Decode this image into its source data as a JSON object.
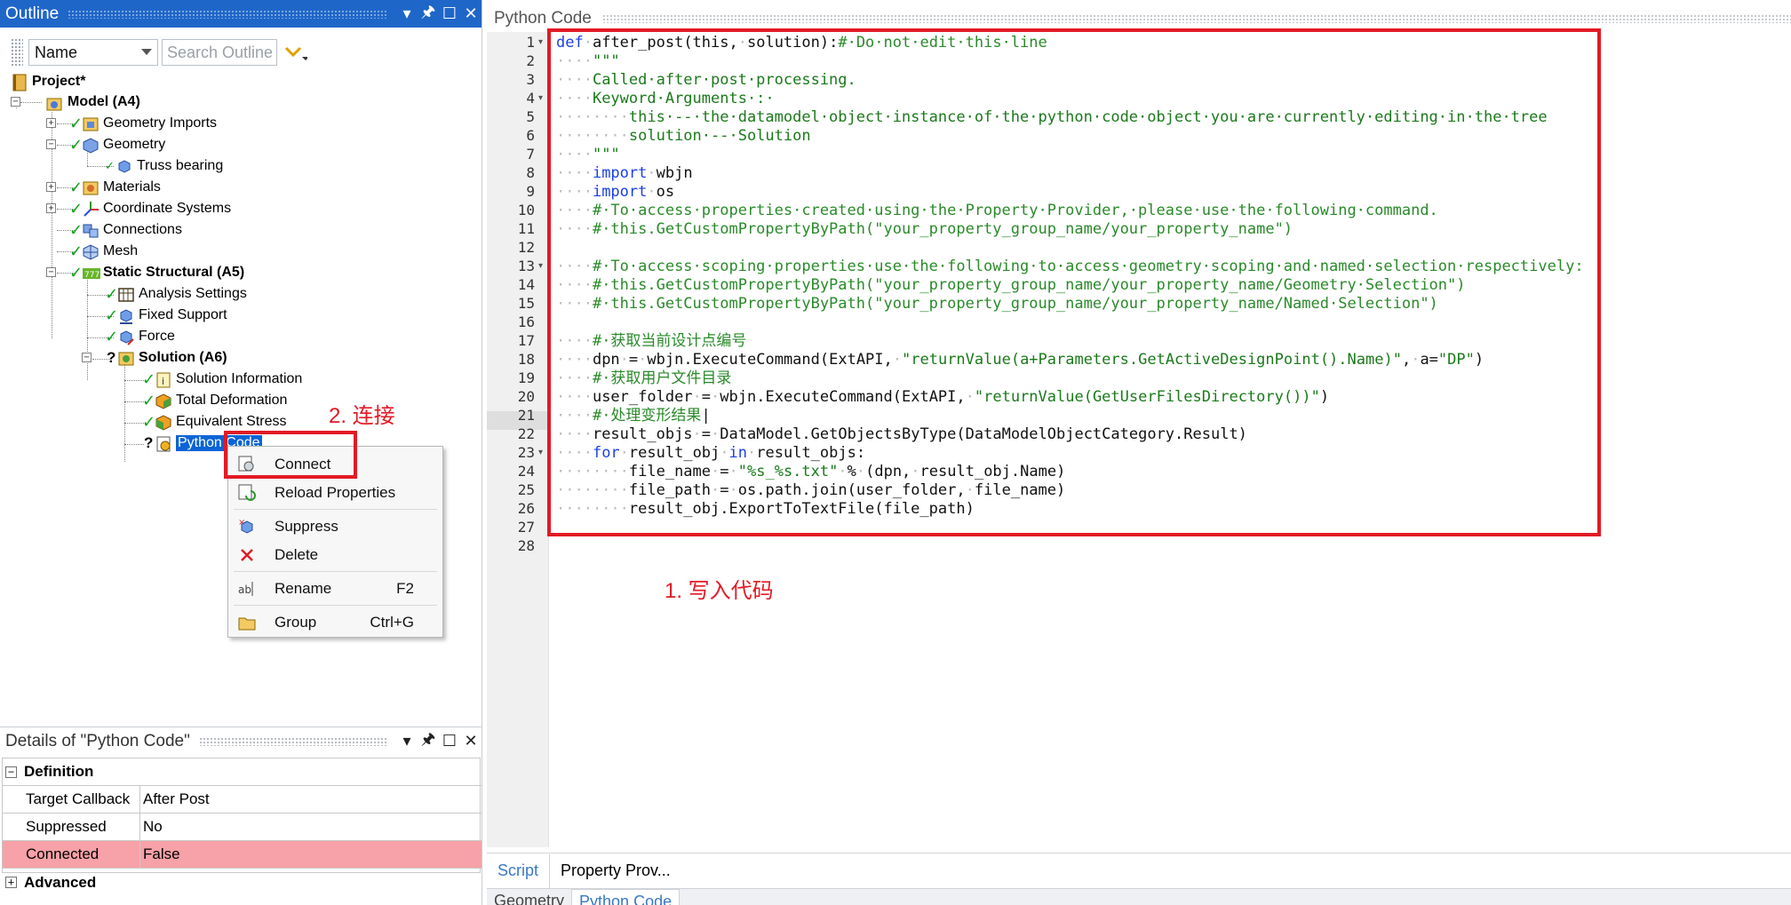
{
  "outline": {
    "title": "Outline",
    "name_filter": "Name",
    "search_placeholder": "Search Outline",
    "tree": {
      "project": "Project*",
      "model": "Model (A4)",
      "geometry_imports": "Geometry Imports",
      "geometry": "Geometry",
      "truss_bearing": "Truss bearing",
      "materials": "Materials",
      "coordinate_systems": "Coordinate Systems",
      "connections": "Connections",
      "mesh": "Mesh",
      "static_structural": "Static Structural (A5)",
      "analysis_settings": "Analysis Settings",
      "fixed_support": "Fixed Support",
      "force": "Force",
      "solution": "Solution (A6)",
      "solution_information": "Solution Information",
      "total_deformation": "Total Deformation",
      "equivalent_stress": "Equivalent Stress",
      "python_code": "Python Code"
    }
  },
  "context_menu": {
    "items": [
      {
        "label": "Connect",
        "shortcut": ""
      },
      {
        "label": "Reload Properties",
        "shortcut": ""
      },
      {
        "label": "Suppress",
        "shortcut": ""
      },
      {
        "label": "Delete",
        "shortcut": ""
      },
      {
        "label": "Rename",
        "shortcut": "F2"
      },
      {
        "label": "Group",
        "shortcut": "Ctrl+G"
      }
    ]
  },
  "annotations": {
    "step1": "1. 写入代码",
    "step2": "2. 连接"
  },
  "details": {
    "title": "Details of \"Python Code\"",
    "section_definition": "Definition",
    "rows": [
      {
        "name": "Target Callback",
        "value": "After Post"
      },
      {
        "name": "Suppressed",
        "value": "No"
      },
      {
        "name": "Connected",
        "value": "False"
      }
    ],
    "section_advanced": "Advanced"
  },
  "editor": {
    "title": "Python Code",
    "current_line": 21,
    "lines": [
      [
        [
          "kw",
          "def"
        ],
        [
          "ws",
          "·"
        ],
        [
          "tx",
          "after_post(this,"
        ],
        [
          "ws",
          "·"
        ],
        [
          "tx",
          "solution):"
        ],
        [
          "cm",
          "#·Do·not·edit·this·line"
        ]
      ],
      [
        [
          "ws",
          "····"
        ],
        [
          "st",
          "\"\"\""
        ]
      ],
      [
        [
          "ws",
          "····"
        ],
        [
          "st",
          "Called·after·post·processing."
        ]
      ],
      [
        [
          "ws",
          "····"
        ],
        [
          "st",
          "Keyword·Arguments·:·"
        ]
      ],
      [
        [
          "ws",
          "········"
        ],
        [
          "st",
          "this·--·the·datamodel·object·instance·of·the·python·code·object·you·are·currently·editing·in·the·tree"
        ]
      ],
      [
        [
          "ws",
          "········"
        ],
        [
          "st",
          "solution·--·Solution"
        ]
      ],
      [
        [
          "ws",
          "····"
        ],
        [
          "st",
          "\"\"\""
        ]
      ],
      [
        [
          "ws",
          "····"
        ],
        [
          "kw",
          "import"
        ],
        [
          "ws",
          "·"
        ],
        [
          "tx",
          "wbjn"
        ]
      ],
      [
        [
          "ws",
          "····"
        ],
        [
          "kw",
          "import"
        ],
        [
          "ws",
          "·"
        ],
        [
          "tx",
          "os"
        ]
      ],
      [
        [
          "ws",
          "····"
        ],
        [
          "cm",
          "#·To·access·properties·created·using·the·Property·Provider,·please·use·the·following·command."
        ]
      ],
      [
        [
          "ws",
          "····"
        ],
        [
          "cm",
          "#·this.GetCustomPropertyByPath(\"your_property_group_name/your_property_name\")"
        ]
      ],
      [],
      [
        [
          "ws",
          "····"
        ],
        [
          "cm",
          "#·To·access·scoping·properties·use·the·following·to·access·geometry·scoping·and·named·selection·respectively:"
        ]
      ],
      [
        [
          "ws",
          "····"
        ],
        [
          "cm",
          "#·this.GetCustomPropertyByPath(\"your_property_group_name/your_property_name/Geometry·Selection\")"
        ]
      ],
      [
        [
          "ws",
          "····"
        ],
        [
          "cm",
          "#·this.GetCustomPropertyByPath(\"your_property_group_name/your_property_name/Named·Selection\")"
        ]
      ],
      [],
      [
        [
          "ws",
          "····"
        ],
        [
          "cm",
          "#·获取当前设计点编号"
        ]
      ],
      [
        [
          "ws",
          "····"
        ],
        [
          "tx",
          "dpn"
        ],
        [
          "ws",
          "·"
        ],
        [
          "op",
          "="
        ],
        [
          "ws",
          "·"
        ],
        [
          "tx",
          "wbjn.ExecuteCommand(ExtAPI,"
        ],
        [
          "ws",
          "·"
        ],
        [
          "st",
          "\"returnValue(a+Parameters.GetActiveDesignPoint().Name)\""
        ],
        [
          "tx",
          ","
        ],
        [
          "ws",
          "·"
        ],
        [
          "tx",
          "a="
        ],
        [
          "st",
          "\"DP\""
        ],
        [
          "tx",
          ")"
        ]
      ],
      [
        [
          "ws",
          "····"
        ],
        [
          "cm",
          "#·获取用户文件目录"
        ]
      ],
      [
        [
          "ws",
          "····"
        ],
        [
          "tx",
          "user_folder"
        ],
        [
          "ws",
          "·"
        ],
        [
          "op",
          "="
        ],
        [
          "ws",
          "·"
        ],
        [
          "tx",
          "wbjn.ExecuteCommand(ExtAPI,"
        ],
        [
          "ws",
          "·"
        ],
        [
          "st",
          "\"returnValue(GetUserFilesDirectory())\""
        ],
        [
          "tx",
          ")"
        ]
      ],
      [
        [
          "ws",
          "····"
        ],
        [
          "cm",
          "#·处理变形结果"
        ],
        [
          "tx",
          "|"
        ]
      ],
      [
        [
          "ws",
          "····"
        ],
        [
          "tx",
          "result_objs"
        ],
        [
          "ws",
          "·"
        ],
        [
          "op",
          "="
        ],
        [
          "ws",
          "·"
        ],
        [
          "tx",
          "DataModel.GetObjectsByType(DataModelObjectCategory.Result)"
        ]
      ],
      [
        [
          "ws",
          "····"
        ],
        [
          "kw",
          "for"
        ],
        [
          "ws",
          "·"
        ],
        [
          "tx",
          "result_obj"
        ],
        [
          "ws",
          "·"
        ],
        [
          "kw",
          "in"
        ],
        [
          "ws",
          "·"
        ],
        [
          "tx",
          "result_objs:"
        ]
      ],
      [
        [
          "ws",
          "········"
        ],
        [
          "tx",
          "file_name"
        ],
        [
          "ws",
          "·"
        ],
        [
          "op",
          "="
        ],
        [
          "ws",
          "·"
        ],
        [
          "st",
          "\"%s_%s.txt\""
        ],
        [
          "ws",
          "·"
        ],
        [
          "op",
          "%"
        ],
        [
          "ws",
          "·"
        ],
        [
          "tx",
          "(dpn,"
        ],
        [
          "ws",
          "·"
        ],
        [
          "tx",
          "result_obj.Name)"
        ]
      ],
      [
        [
          "ws",
          "········"
        ],
        [
          "tx",
          "file_path"
        ],
        [
          "ws",
          "·"
        ],
        [
          "op",
          "="
        ],
        [
          "ws",
          "·"
        ],
        [
          "tx",
          "os.path.join(user_folder,"
        ],
        [
          "ws",
          "·"
        ],
        [
          "tx",
          "file_name)"
        ]
      ],
      [
        [
          "ws",
          "········"
        ],
        [
          "tx",
          "result_obj.ExportToTextFile(file_path)"
        ]
      ],
      [],
      []
    ],
    "fold_lines": [
      1,
      4,
      13,
      23
    ],
    "bottom_tabs": [
      "Script",
      "Property Prov..."
    ],
    "doc_tabs": [
      "Geometry",
      "Python Code"
    ]
  }
}
